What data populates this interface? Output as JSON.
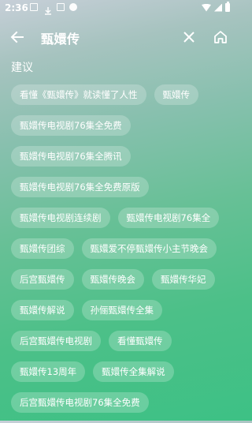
{
  "status_bar": {
    "time": "2:36"
  },
  "toolbar": {
    "query": "甄嬛传"
  },
  "suggestions": {
    "title": "建议",
    "rows": [
      [
        "看懂《甄嬛传》就读懂了人性",
        "甄嬛传"
      ],
      [
        "甄嬛传电视剧76集全免费"
      ],
      [
        "甄嬛传电视剧76集全腾讯"
      ],
      [
        "甄嬛传电视剧76集全免费原版"
      ],
      [
        "甄嬛传电视剧连续剧",
        "甄嬛传电视剧76集全"
      ],
      [
        "甄嬛传团综",
        "甄嬛爱不停甄嬛传小主节晚会"
      ],
      [
        "后宫甄嬛传",
        "甄嬛传晚会",
        "甄嬛传华妃"
      ],
      [
        "甄嬛传解说",
        "孙俪甄嬛传全集"
      ],
      [
        "后宫甄嬛传电视剧",
        "看懂甄嬛传"
      ],
      [
        "甄嬛传13周年",
        "甄嬛传全集解说"
      ],
      [
        "后宫甄嬛传电视剧76集全免费"
      ]
    ]
  },
  "icons": {
    "back": "arrow-left-icon",
    "clear": "close-icon",
    "home": "home-icon"
  }
}
